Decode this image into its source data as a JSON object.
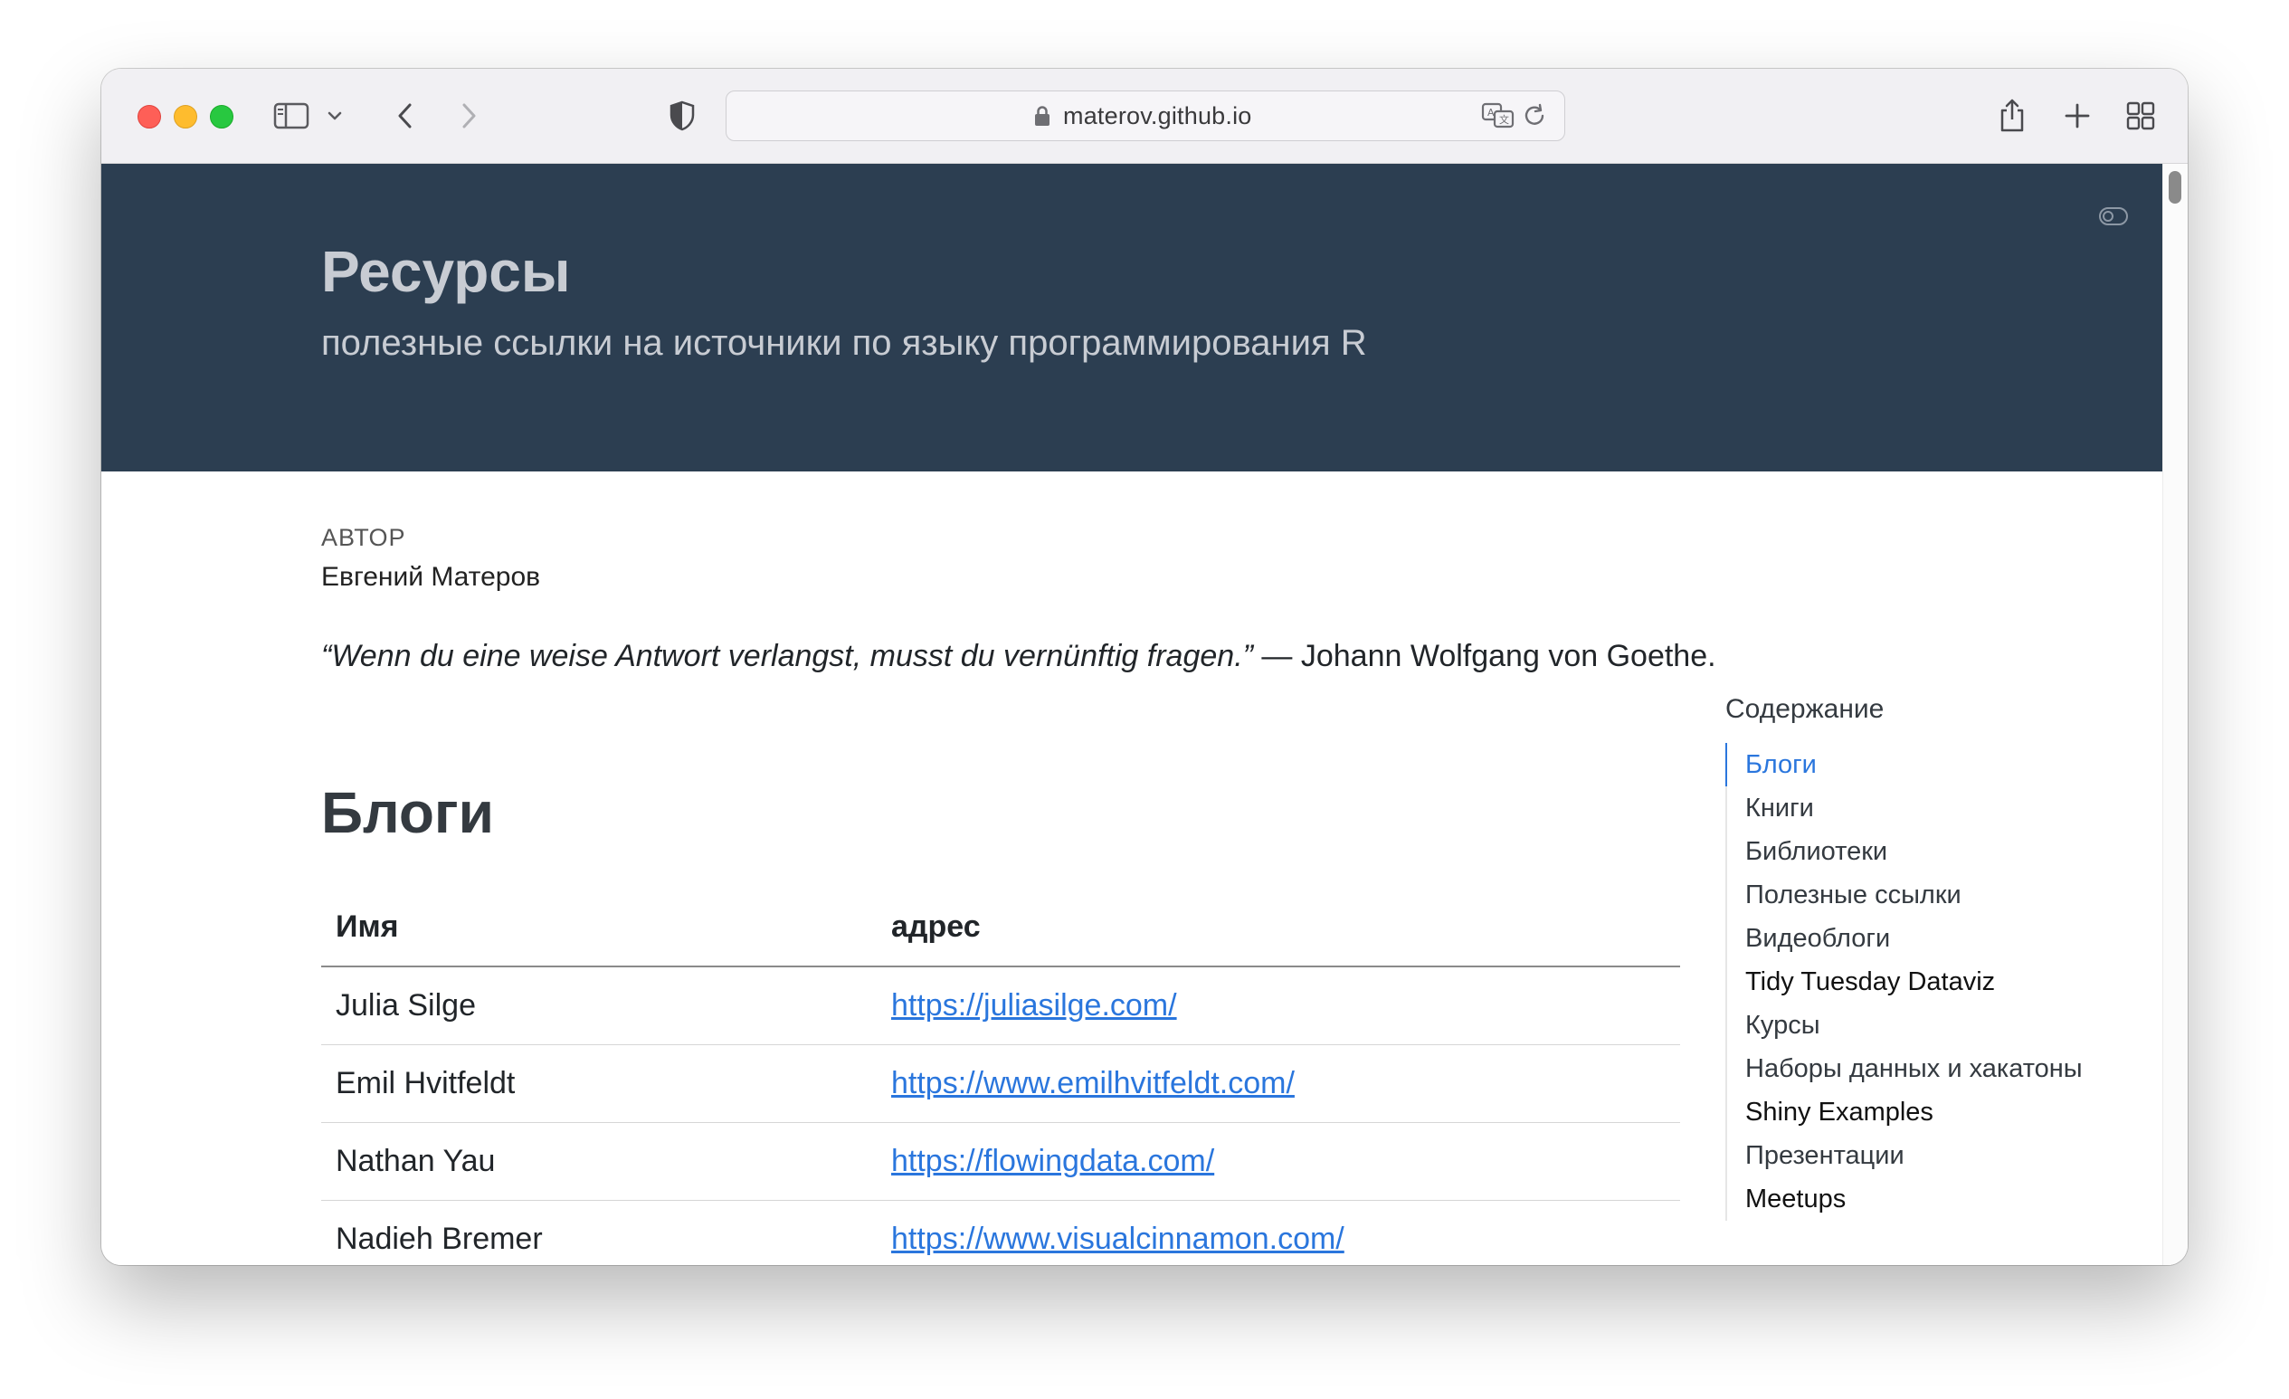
{
  "browser": {
    "url": "materov.github.io"
  },
  "header": {
    "title": "Ресурсы",
    "subtitle": "полезные ссылки на источники по языку программирования R"
  },
  "meta": {
    "author_label": "АВТОР",
    "author_name": "Евгений Матеров"
  },
  "quote": {
    "text": "“Wenn du eine weise Antwort verlangst, musst du vernünftig fragen.”",
    "attribution": " — Johann Wolfgang von Goethe."
  },
  "section": {
    "heading": "Блоги",
    "columns": [
      "Имя",
      "адрес"
    ],
    "rows": [
      {
        "name": "Julia Silge",
        "url": "https://juliasilge.com/"
      },
      {
        "name": "Emil Hvitfeldt",
        "url": "https://www.emilhvitfeldt.com/"
      },
      {
        "name": "Nathan Yau",
        "url": "https://flowingdata.com/"
      },
      {
        "name": "Nadieh Bremer",
        "url": "https://www.visualcinnamon.com/"
      }
    ]
  },
  "toc": {
    "title": "Содержание",
    "items": [
      {
        "label": "Блоги"
      },
      {
        "label": "Книги"
      },
      {
        "label": "Библиотеки"
      },
      {
        "label": "Полезные ссылки"
      },
      {
        "label": "Видеоблоги"
      },
      {
        "label": "Tidy Tuesday Dataviz"
      },
      {
        "label": "Курсы"
      },
      {
        "label": "Наборы данных и хакатоны"
      },
      {
        "label": "Shiny Examples"
      },
      {
        "label": "Презентации"
      },
      {
        "label": "Meetups"
      }
    ]
  },
  "colors": {
    "banner": "#2c3e51",
    "link": "#2a76dd"
  }
}
